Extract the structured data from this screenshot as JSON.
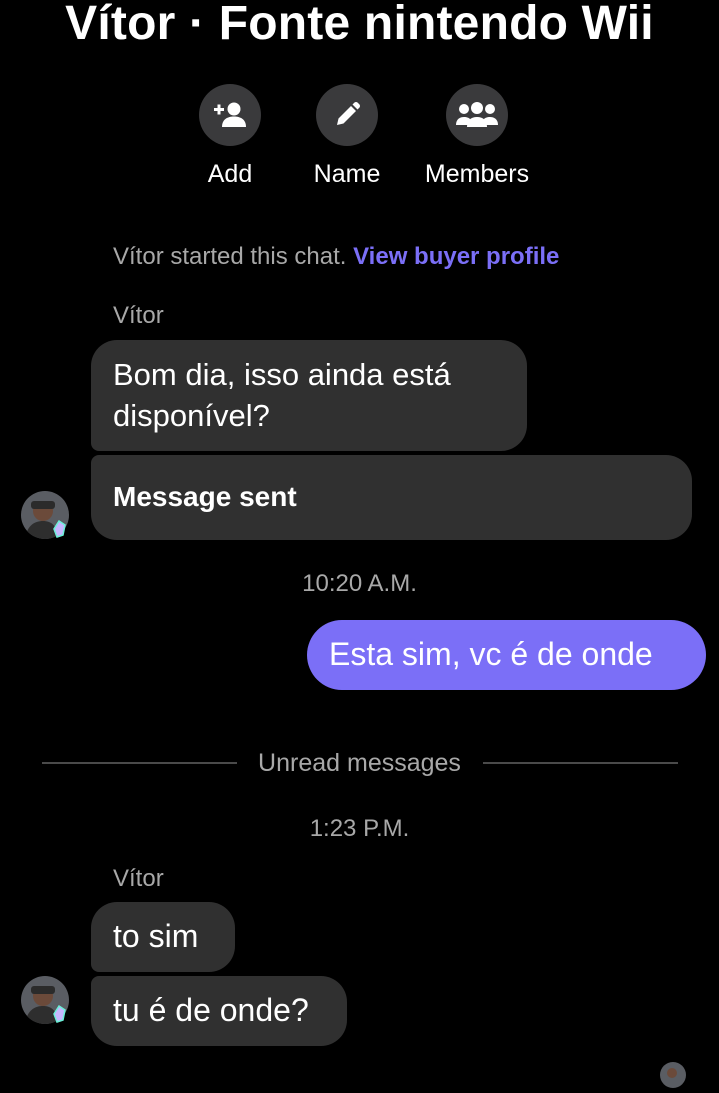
{
  "header": {
    "title": "Vítor · Fonte nintendo Wii"
  },
  "actions": [
    {
      "label": "Add",
      "icon": "add-person-icon"
    },
    {
      "label": "Name",
      "icon": "pencil-icon"
    },
    {
      "label": "Members",
      "icon": "group-icon"
    }
  ],
  "system": {
    "started_text": "Vítor started this chat.",
    "buyer_link": "View buyer profile"
  },
  "messages": {
    "group1_sender": "Vítor",
    "m1": "Bom dia, isso ainda está disponível?",
    "m2": "Message sent",
    "time1": "10:20 A.M.",
    "outgoing1": "Esta sim, vc é de onde",
    "unread_label": "Unread messages",
    "time2": "1:23 P.M.",
    "group2_sender": "Vítor",
    "m3": "to sim",
    "m4": "tu é de onde?"
  },
  "colors": {
    "background": "#000000",
    "incoming_bubble": "#303030",
    "outgoing_bubble": "#7b6ff7",
    "link": "#7b6ff7",
    "secondary_text": "#a8a8a8"
  }
}
